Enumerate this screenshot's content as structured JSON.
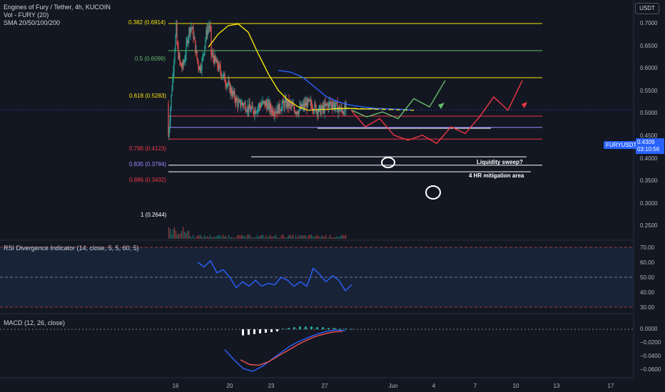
{
  "header": {
    "symbol_line": "Engines of Fury / Tether, 4h, KUCOIN",
    "vol_line": "Vol - FURY (20)",
    "sma_line": "SMA 20/50/100/200"
  },
  "currency": "USDT",
  "symbol_tag": "FURYUSDT",
  "last_price": "0.4309",
  "countdown": "03:10:56",
  "annotations": {
    "liquidity": "Liquidity sweep?",
    "mitigation": "4 HR mitigation area"
  },
  "colors": {
    "bull": "#26a69a",
    "bear": "#ef5350",
    "accent": "#2962ff",
    "sma_yellow": "#f5e50a",
    "sma_blue": "#2962ff",
    "background": "#131722"
  },
  "chart_data": [
    {
      "type": "line",
      "title": "Engines of Fury / Tether, 4h, KUCOIN",
      "y_ticks": [
        "0.7000",
        "0.6500",
        "0.6000",
        "0.5500",
        "0.5000",
        "0.4500",
        "0.4000",
        "0.3500",
        "0.3000",
        "0.2500"
      ],
      "ylim": [
        0.22,
        0.75
      ],
      "x_ticks": [
        "16",
        "20",
        "23",
        "27",
        "Jun",
        "4",
        "7",
        "10",
        "13",
        "17"
      ],
      "fib_levels": [
        {
          "label": "0.382 (0.6914)",
          "value": 0.6914,
          "color": "#f5e50a"
        },
        {
          "label": "0.5 (0.6099)",
          "value": 0.6099,
          "color": "#66bb6a"
        },
        {
          "label": "0.618 (0.5283)",
          "value": 0.5283,
          "color": "#f5e50a"
        },
        {
          "label": "0.786 (0.4123)",
          "value": 0.4123,
          "color": "#f23645"
        },
        {
          "label": "0.835 (0.3784)",
          "value": 0.3784,
          "color": "#9c88ff"
        },
        {
          "label": "0.886 (0.3432)",
          "value": 0.3432,
          "color": "#f23645"
        },
        {
          "label": "1 (0.2644)",
          "value": 0.2644,
          "color": "#ffffff"
        }
      ],
      "sma_yellow": [
        0.62,
        0.66,
        0.685,
        0.69,
        0.665,
        0.6,
        0.54,
        0.49,
        0.46,
        0.44,
        0.43,
        0.432,
        0.433,
        0.435,
        0.436,
        0.434,
        0.434,
        0.435,
        0.434,
        0.433,
        0.431
      ],
      "sma_blue": [
        0.55,
        0.545,
        0.53,
        0.5,
        0.47,
        0.455,
        0.445,
        0.44,
        0.436,
        0.434,
        0.433,
        0.431
      ],
      "green_projection": [
        0.4309,
        0.41,
        0.425,
        0.405,
        0.465,
        0.44,
        0.52
      ],
      "red_projection": [
        0.4309,
        0.38,
        0.405,
        0.355,
        0.34,
        0.355,
        0.33,
        0.38,
        0.36,
        0.41,
        0.47,
        0.43,
        0.52
      ]
    },
    {
      "type": "line",
      "title": "RSI Divergence Indicator (14, close, 5, 5, 60, 5)",
      "y_ticks": [
        "70.00",
        "60.00",
        "50.00",
        "40.00",
        "30.00"
      ],
      "ylim": [
        28,
        72
      ],
      "values": [
        60,
        57,
        61,
        53,
        55,
        50,
        43,
        47,
        44,
        48,
        44,
        46,
        45,
        50,
        48,
        44,
        47,
        44,
        56,
        52,
        47,
        51,
        48,
        41,
        45
      ]
    },
    {
      "type": "bar",
      "title": "MACD (12, 26, close)",
      "y_ticks": [
        "0.0000",
        "−0.0200",
        "−0.0400",
        "−0.0600"
      ],
      "ylim": [
        -0.066,
        0.004
      ],
      "histogram": [
        -0.009,
        -0.008,
        -0.007,
        -0.006,
        -0.005,
        -0.004,
        -0.003,
        0.001,
        0.002,
        0.003,
        0.004,
        0.004,
        0.004,
        0.003,
        0.003,
        0.002,
        0.002,
        0.001,
        0.001,
        0.0005
      ],
      "macd": [
        -0.03,
        -0.045,
        -0.058,
        -0.062,
        -0.055,
        -0.045,
        -0.035,
        -0.025,
        -0.018,
        -0.012,
        -0.007,
        -0.003,
        -0.001,
        -0.002
      ],
      "signal": [
        -0.045,
        -0.052,
        -0.053,
        -0.048,
        -0.04,
        -0.032,
        -0.024,
        -0.017,
        -0.011,
        -0.007,
        -0.004,
        -0.003
      ]
    }
  ]
}
